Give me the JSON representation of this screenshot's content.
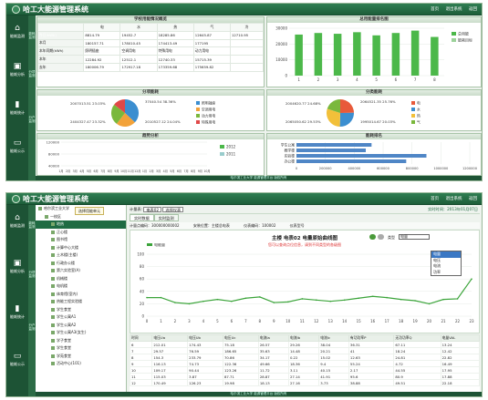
{
  "app_title": "哈工大能源管理系统",
  "header_links": [
    "首页",
    "退出系统",
    "返回"
  ],
  "nav": [
    {
      "icon": "building-icon",
      "label": "能耗监测"
    },
    {
      "icon": "monitor-icon",
      "label": "能耗分析"
    },
    {
      "icon": "bar-icon",
      "label": "能耗统计"
    },
    {
      "icon": "screen-icon",
      "label": "能耗公示"
    }
  ],
  "sub_nav": [
    "能耗监测",
    "分项监测",
    "分户监测"
  ],
  "footer": "哈尔滨工业大学  能源管理平台  版权所有",
  "stats": {
    "title": "学校用能情况概览",
    "headers": [
      "",
      "电",
      "水",
      "热",
      "气",
      "冷"
    ],
    "rows": [
      [
        "今日(kWh)",
        "8814.79",
        "19452.7",
        "18285.86",
        "12645.87",
        "12710.95"
      ],
      [
        "本月",
        "180157.71",
        "178010.45",
        "174413.49",
        "177195",
        ""
      ],
      [
        "本年同期(kWh)",
        "照明插座",
        "空调用电",
        "特殊用电",
        "动力用电",
        ""
      ],
      [
        "本年",
        "12284.92",
        "12512.1",
        "12740.33",
        "15715.39",
        ""
      ],
      [
        "去年",
        "180006.79",
        "172917.18",
        "173359.68",
        "175659.82",
        ""
      ]
    ]
  },
  "top_bar": {
    "title": "总用能量排名图",
    "legend": [
      "总用能",
      "能耗目标"
    ],
    "ylabels": [
      "30000",
      "20000",
      "10000",
      "0"
    ],
    "xlabels": [
      "1",
      "2",
      "3",
      "4",
      "5",
      "6",
      "7",
      "8"
    ],
    "values": [
      26000,
      27000,
      26500,
      27500,
      25500,
      27000,
      28500,
      24500
    ]
  },
  "pie1": {
    "title": "分项能耗",
    "slices": [
      {
        "label": "照明插座",
        "pct": 37.03,
        "color": "#3b8ed0"
      },
      {
        "label": "空调用电",
        "pct": 23.34,
        "color": "#f2a23a"
      },
      {
        "label": "动力用电",
        "pct": 25.13,
        "color": "#7ab83c"
      },
      {
        "label": "特殊用电",
        "pct": 14.5,
        "color": "#e04848"
      }
    ],
    "callouts": [
      "2007013.51  23.03%",
      "37040.54  38.36%",
      "2404327.47  23.32%",
      "2010527.12  24.04%"
    ]
  },
  "pie2": {
    "title": "分类能耗",
    "slices": [
      {
        "label": "电",
        "pct": 24.68,
        "color": "#e85a3a"
      },
      {
        "label": "水",
        "pct": 25.76,
        "color": "#3b8ed0"
      },
      {
        "label": "热",
        "pct": 29.53,
        "color": "#f2c03a"
      },
      {
        "label": "气",
        "pct": 20.03,
        "color": "#7ab83c"
      }
    ],
    "callouts": [
      "2004620.77  24.68%",
      "2064521.35  25.76%",
      "2065050.62  29.53%",
      "1995014.67  20.03%"
    ]
  },
  "trend": {
    "title": "趋势分析",
    "legend": [
      "2012",
      "2011"
    ],
    "ylabels": [
      "120000",
      "80000",
      "40000"
    ],
    "xlabels": [
      "1月",
      "2月",
      "3月",
      "4月",
      "5月",
      "6月",
      "7月",
      "8月",
      "9月",
      "10月",
      "11月",
      "12月",
      "1月",
      "2月",
      "3月",
      "4月",
      "5月",
      "6月",
      "7月",
      "8月",
      "9月",
      "10月"
    ]
  },
  "hbar": {
    "title": "能耗排名",
    "items": [
      {
        "label": "学生公寓",
        "value": 520000
      },
      {
        "label": "教学楼",
        "value": 480000
      },
      {
        "label": "实验楼",
        "value": 900000
      },
      {
        "label": "办公楼",
        "value": 760000
      }
    ],
    "xlabels": [
      "0",
      "200000",
      "400000",
      "600000",
      "800000",
      "1000000",
      "1200000"
    ]
  },
  "s2": {
    "tree": [
      {
        "label": "哈尔滨工业大学",
        "d": 0
      },
      {
        "label": "一校区",
        "d": 1
      },
      {
        "label": "地热",
        "d": 2,
        "sel": true
      },
      {
        "label": "正心楼",
        "d": 2
      },
      {
        "label": "图书馆",
        "d": 2
      },
      {
        "label": "计算中心大楼",
        "d": 2
      },
      {
        "label": "土木楼(主楼)",
        "d": 2
      },
      {
        "label": "行政办公楼",
        "d": 2
      },
      {
        "label": "第六实验室(A)",
        "d": 2
      },
      {
        "label": "机械楼",
        "d": 2
      },
      {
        "label": "电机楼",
        "d": 2
      },
      {
        "label": "体育馆(室内)",
        "d": 2
      },
      {
        "label": "热能工程实验楼",
        "d": 2
      },
      {
        "label": "学生食堂",
        "d": 2
      },
      {
        "label": "学生公寓A1",
        "d": 2
      },
      {
        "label": "学生公寓A2",
        "d": 2
      },
      {
        "label": "学生公寓A3(女生)",
        "d": 2
      },
      {
        "label": "学子食堂",
        "d": 2
      },
      {
        "label": "学生食堂",
        "d": 2
      },
      {
        "label": "学苑食堂",
        "d": 2
      },
      {
        "label": "活动中心(101)",
        "d": 2
      }
    ],
    "balloon": "选择用能单元",
    "toolbar": {
      "meter_label": "计量表:",
      "meter_value": "电表02",
      "type_value": "选择仪表",
      "time": "实时时间：2013年01月07日"
    },
    "tabs": [
      "实时数据",
      "实时监测"
    ],
    "info": [
      "计量点编码：300000000002",
      "安装位置：主楼总电表",
      "仪表编码：100002",
      "仪表型号"
    ],
    "chart_title": "主楼 电表02 电量原始曲线图",
    "chart_subtitle": "您可以查询点位信息，请到不同类型的各级图",
    "legend": "电能量",
    "type_label": "类型",
    "dropdown": {
      "value": "电量",
      "options": [
        "电量",
        "电压",
        "电流",
        "功率"
      ]
    },
    "ylabels": [
      "100",
      "80",
      "60",
      "40",
      "20",
      "0"
    ],
    "xlabels": [
      "0",
      "1",
      "2",
      "3",
      "4",
      "5",
      "6",
      "7",
      "8",
      "9",
      "10",
      "11",
      "12",
      "13",
      "14",
      "15",
      "16",
      "17",
      "18",
      "19",
      "20",
      "21",
      "22",
      "23"
    ],
    "series": [
      30,
      30,
      22,
      20,
      24,
      27,
      24,
      29,
      31,
      22,
      23,
      28,
      26,
      24,
      26,
      29,
      32,
      30,
      27,
      25,
      20,
      27,
      28,
      60
    ],
    "columns": [
      "时间",
      "电压Ua",
      "电压Ub",
      "电压Uc",
      "电流Ia",
      "电流Ib",
      "电流Ic",
      "有功功率P",
      "无功功率Q",
      "电量VAL"
    ],
    "rows": [
      [
        "6",
        "212.01",
        "174.43",
        "75.18",
        "26.57",
        "29.26",
        "38.04",
        "36.31",
        "67.11",
        "13.24"
      ],
      [
        "7",
        "29.57",
        "76.59",
        "186.65",
        "35.63",
        "14.48",
        "20.21",
        "41",
        "18.24",
        "12.42"
      ],
      [
        "8",
        "154.3",
        "233.79",
        "70.86",
        "34.17",
        "0.22",
        "15.02",
        "12.63",
        "24.81",
        "22.82"
      ],
      [
        "9",
        "116.13",
        "74.73",
        "122.36",
        "49.66",
        "18.36",
        "9.4",
        "55.24",
        "4.72",
        "16.49"
      ],
      [
        "10",
        "109.17",
        "90.44",
        "123.26",
        "11.72",
        "3.11",
        "40.15",
        "2.17",
        "44.55",
        "17.95"
      ],
      [
        "11",
        "115.03",
        "3.87",
        "87.71",
        "28.87",
        "27.14",
        "41.91",
        "95.6",
        "80.9",
        "17.88"
      ],
      [
        "12",
        "170.49",
        "126.23",
        "19.98",
        "18.13",
        "27.16",
        "3.73",
        "38.88",
        "49.51",
        "22.18"
      ]
    ]
  }
}
